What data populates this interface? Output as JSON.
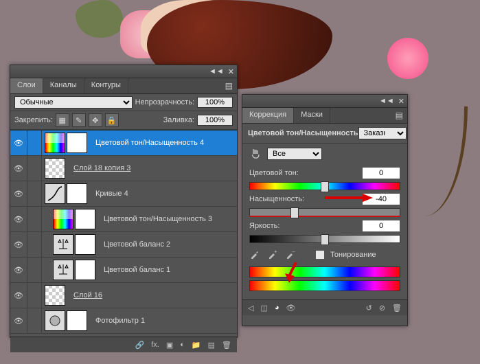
{
  "layersPanel": {
    "tabs": [
      "Слои",
      "Каналы",
      "Контуры"
    ],
    "activeTab": 0,
    "blendMode": "Обычные",
    "opacityLabel": "Непрозрачность:",
    "opacityValue": "100%",
    "lockLabel": "Закрепить:",
    "fillLabel": "Заливка:",
    "fillValue": "100%",
    "layers": [
      {
        "name": "Цветовой тон/Насыщенность 4",
        "selected": true,
        "icon": "hue-sat",
        "mask": true,
        "underline": false
      },
      {
        "name": "Слой 18 копия 3",
        "selected": false,
        "icon": "checker",
        "mask": false,
        "underline": true
      },
      {
        "name": "Кривые 4",
        "selected": false,
        "icon": "curves",
        "mask": true,
        "underline": false
      },
      {
        "name": "Цветовой тон/Насыщенность 3",
        "selected": false,
        "icon": "hue-sat",
        "mask": true,
        "underline": false,
        "indent": true
      },
      {
        "name": "Цветовой баланс 2",
        "selected": false,
        "icon": "balance",
        "mask": true,
        "underline": false,
        "indent": true
      },
      {
        "name": "Цветовой баланс 1",
        "selected": false,
        "icon": "balance",
        "mask": true,
        "underline": false,
        "indent": true
      },
      {
        "name": "Слой 16",
        "selected": false,
        "icon": "checker",
        "mask": false,
        "underline": true
      },
      {
        "name": "Фотофильтр 1",
        "selected": false,
        "icon": "photo-filter",
        "mask": true,
        "underline": false
      }
    ],
    "footer": {
      "link": "🔗",
      "fx": "fx.",
      "mask": "▣",
      "adj": "◐",
      "group": "📁",
      "new": "▤",
      "trash": "🗑"
    }
  },
  "adjustPanel": {
    "tabs": [
      "Коррекция",
      "Маски"
    ],
    "activeTab": 0,
    "title": "Цветовой тон/Насыщенность",
    "preset": "Заказная",
    "channel": "Все",
    "sliders": {
      "hue": {
        "label": "Цветовой тон:",
        "value": "0",
        "pos": 50
      },
      "sat": {
        "label": "Насыщенность:",
        "value": "-40",
        "pos": 30
      },
      "light": {
        "label": "Яркость:",
        "value": "0",
        "pos": 50
      }
    },
    "colorize": "Тонирование"
  }
}
